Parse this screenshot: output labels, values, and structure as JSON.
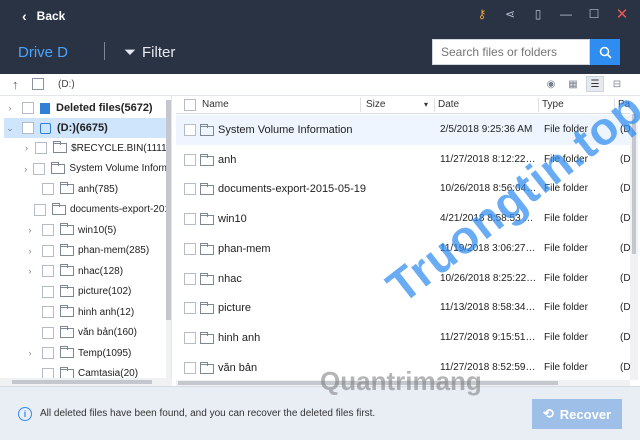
{
  "titlebar": {
    "back_label": "Back",
    "icons": [
      "key-icon",
      "share-icon",
      "minimize-tray-icon",
      "restore-icon",
      "maximize-icon",
      "close-icon"
    ]
  },
  "header": {
    "drive_label": "Drive D",
    "filter_label": "Filter",
    "search_placeholder": "Search files or folders"
  },
  "pathbar": {
    "path": "(D:)"
  },
  "tree": {
    "deleted": "Deleted files(5672)",
    "root": "(D:)(6675)",
    "items": [
      {
        "label": "$RECYCLE.BIN(1111)",
        "expandable": true
      },
      {
        "label": "System Volume Inform",
        "expandable": true
      },
      {
        "label": "anh(785)",
        "expandable": false
      },
      {
        "label": "documents-export-201",
        "expandable": false
      },
      {
        "label": "win10(5)",
        "expandable": true
      },
      {
        "label": "phan-mem(285)",
        "expandable": true
      },
      {
        "label": "nhac(128)",
        "expandable": true
      },
      {
        "label": "picture(102)",
        "expandable": false
      },
      {
        "label": "hinh anh(12)",
        "expandable": false
      },
      {
        "label": "văn bản(160)",
        "expandable": false
      },
      {
        "label": "Temp(1095)",
        "expandable": true
      },
      {
        "label": "Camtasia(20)",
        "expandable": false
      }
    ]
  },
  "columns": {
    "name": "Name",
    "size": "Size",
    "date": "Date",
    "type": "Type",
    "path": "Path"
  },
  "files": [
    {
      "name": "System Volume Information",
      "date": "2/5/2018 9:25:36 AM",
      "type": "File folder",
      "path": "(D:"
    },
    {
      "name": "anh",
      "date": "11/27/2018 8:12:22…",
      "type": "File folder",
      "path": "(D:"
    },
    {
      "name": "documents-export-2015-05-19",
      "date": "10/26/2018 8:56:04…",
      "type": "File folder",
      "path": "(D:"
    },
    {
      "name": "win10",
      "date": "4/21/2018 8:58:53 …",
      "type": "File folder",
      "path": "(D:"
    },
    {
      "name": "phan-mem",
      "date": "11/19/2018 3:06:27…",
      "type": "File folder",
      "path": "(D:"
    },
    {
      "name": "nhac",
      "date": "10/26/2018 8:25:22…",
      "type": "File folder",
      "path": "(D:"
    },
    {
      "name": "picture",
      "date": "11/13/2018 8:58:34…",
      "type": "File folder",
      "path": "(D:"
    },
    {
      "name": "hinh anh",
      "date": "11/27/2018 9:15:51…",
      "type": "File folder",
      "path": "(D:"
    },
    {
      "name": "văn bản",
      "date": "11/27/2018 8:52:59…",
      "type": "File folder",
      "path": "(D:"
    }
  ],
  "footer": {
    "message": "All deleted files have been found, and you can recover the deleted files first.",
    "recover_label": "Recover"
  },
  "watermarks": {
    "main": "Truongtin.top",
    "secondary": "Quantrimang"
  },
  "colors": {
    "titlebar": "#2a3344",
    "accent": "#2f8cf0",
    "selection": "#cfe5fb",
    "recover_button": "#9dbfe8"
  }
}
